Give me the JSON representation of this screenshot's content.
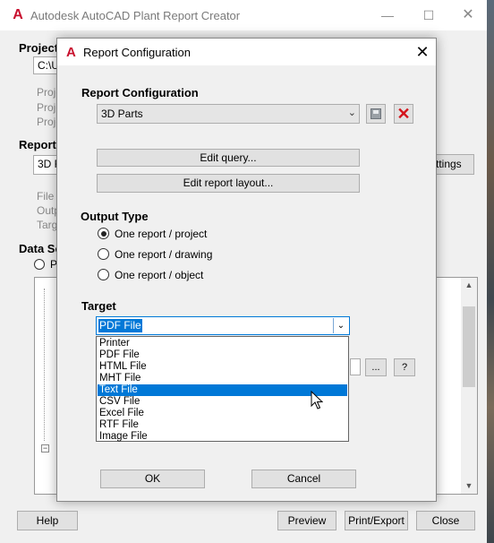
{
  "main_window": {
    "title": "Autodesk AutoCAD Plant Report Creator",
    "project_heading": "Project",
    "project_path": "C:\\U",
    "project_props": [
      "Proje",
      "Proje",
      "Proje"
    ],
    "report_heading": "Report",
    "report_value": "3D F",
    "settings_button": "ttings",
    "report_props": [
      "File F",
      "Outp",
      "Targ"
    ],
    "data_source_heading": "Data Sc",
    "data_source_radio": "P",
    "footer": {
      "help": "Help",
      "preview": "Preview",
      "print_export": "Print/Export",
      "close": "Close"
    }
  },
  "dialog": {
    "title": "Report Configuration",
    "config_heading": "Report Configuration",
    "config_value": "3D Parts",
    "edit_query": "Edit query...",
    "edit_layout": "Edit report layout...",
    "output_heading": "Output Type",
    "output_options": [
      {
        "label": "One report / project",
        "checked": true
      },
      {
        "label": "One report / drawing",
        "checked": false
      },
      {
        "label": "One report / object",
        "checked": false
      }
    ],
    "target_heading": "Target",
    "target_value": "PDF File",
    "target_options": [
      "Printer",
      "PDF File",
      "HTML File",
      "MHT File",
      "Text File",
      "CSV File",
      "Excel File",
      "RTF File",
      "Image File"
    ],
    "highlighted_option": "Text File",
    "browse_button": "...",
    "help_button": "?",
    "ok": "OK",
    "cancel": "Cancel"
  },
  "colors": {
    "accent": "#0078d7",
    "logo_red": "#c8102e",
    "delete_red": "#d4141c"
  },
  "icons": {
    "app": "autocad-logo-icon",
    "save": "save-disk-icon",
    "delete": "delete-x-icon",
    "dropdown": "chevron-down-icon"
  }
}
